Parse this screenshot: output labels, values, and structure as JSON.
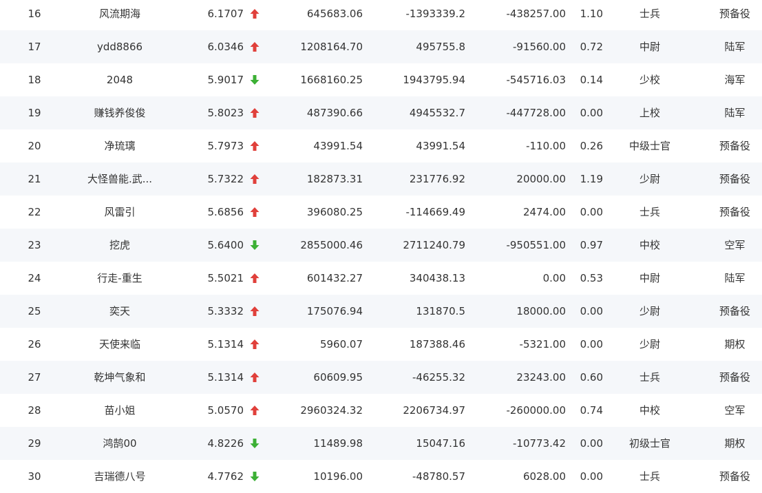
{
  "colors": {
    "up": "#e0403b",
    "down": "#3cb035",
    "text": "#333333",
    "row_alt": "#f5f7fa"
  },
  "icons": {
    "up": "arrow-up-icon",
    "down": "arrow-down-icon"
  },
  "rows": [
    {
      "rank": "16",
      "name": "风流期海",
      "score": "6.1707",
      "trend": "up",
      "v1": "645683.06",
      "v2": "-1393339.2",
      "v3": "-438257.00",
      "ratio": "1.10",
      "title": "士兵",
      "branch": "预备役"
    },
    {
      "rank": "17",
      "name": "ydd8866",
      "score": "6.0346",
      "trend": "up",
      "v1": "1208164.70",
      "v2": "495755.8",
      "v3": "-91560.00",
      "ratio": "0.72",
      "title": "中尉",
      "branch": "陆军"
    },
    {
      "rank": "18",
      "name": "2048",
      "score": "5.9017",
      "trend": "down",
      "v1": "1668160.25",
      "v2": "1943795.94",
      "v3": "-545716.03",
      "ratio": "0.14",
      "title": "少校",
      "branch": "海军"
    },
    {
      "rank": "19",
      "name": "赚钱养俊俊",
      "score": "5.8023",
      "trend": "up",
      "v1": "487390.66",
      "v2": "4945532.7",
      "v3": "-447728.00",
      "ratio": "0.00",
      "title": "上校",
      "branch": "陆军"
    },
    {
      "rank": "20",
      "name": "净琉璃",
      "score": "5.7973",
      "trend": "up",
      "v1": "43991.54",
      "v2": "43991.54",
      "v3": "-110.00",
      "ratio": "0.26",
      "title": "中级士官",
      "branch": "预备役"
    },
    {
      "rank": "21",
      "name": "大怪兽能.武...",
      "score": "5.7322",
      "trend": "up",
      "v1": "182873.31",
      "v2": "231776.92",
      "v3": "20000.00",
      "ratio": "1.19",
      "title": "少尉",
      "branch": "预备役"
    },
    {
      "rank": "22",
      "name": "风雷引",
      "score": "5.6856",
      "trend": "up",
      "v1": "396080.25",
      "v2": "-114669.49",
      "v3": "2474.00",
      "ratio": "0.00",
      "title": "士兵",
      "branch": "预备役"
    },
    {
      "rank": "23",
      "name": "挖虎",
      "score": "5.6400",
      "trend": "down",
      "v1": "2855000.46",
      "v2": "2711240.79",
      "v3": "-950551.00",
      "ratio": "0.97",
      "title": "中校",
      "branch": "空军"
    },
    {
      "rank": "24",
      "name": "行走-重生",
      "score": "5.5021",
      "trend": "up",
      "v1": "601432.27",
      "v2": "340438.13",
      "v3": "0.00",
      "ratio": "0.53",
      "title": "中尉",
      "branch": "陆军"
    },
    {
      "rank": "25",
      "name": "奕天",
      "score": "5.3332",
      "trend": "up",
      "v1": "175076.94",
      "v2": "131870.5",
      "v3": "18000.00",
      "ratio": "0.00",
      "title": "少尉",
      "branch": "预备役"
    },
    {
      "rank": "26",
      "name": "天使来临",
      "score": "5.1314",
      "trend": "up",
      "v1": "5960.07",
      "v2": "187388.46",
      "v3": "-5321.00",
      "ratio": "0.00",
      "title": "少尉",
      "branch": "期权"
    },
    {
      "rank": "27",
      "name": "乾坤气象和",
      "score": "5.1314",
      "trend": "up",
      "v1": "60609.95",
      "v2": "-46255.32",
      "v3": "23243.00",
      "ratio": "0.60",
      "title": "士兵",
      "branch": "预备役"
    },
    {
      "rank": "28",
      "name": "苗小姐",
      "score": "5.0570",
      "trend": "up",
      "v1": "2960324.32",
      "v2": "2206734.97",
      "v3": "-260000.00",
      "ratio": "0.74",
      "title": "中校",
      "branch": "空军"
    },
    {
      "rank": "29",
      "name": "鸿鹄00",
      "score": "4.8226",
      "trend": "down",
      "v1": "11489.98",
      "v2": "15047.16",
      "v3": "-10773.42",
      "ratio": "0.00",
      "title": "初级士官",
      "branch": "期权"
    },
    {
      "rank": "30",
      "name": "吉瑞德八号",
      "score": "4.7762",
      "trend": "down",
      "v1": "10196.00",
      "v2": "-48780.57",
      "v3": "6028.00",
      "ratio": "0.00",
      "title": "士兵",
      "branch": "预备役"
    }
  ]
}
